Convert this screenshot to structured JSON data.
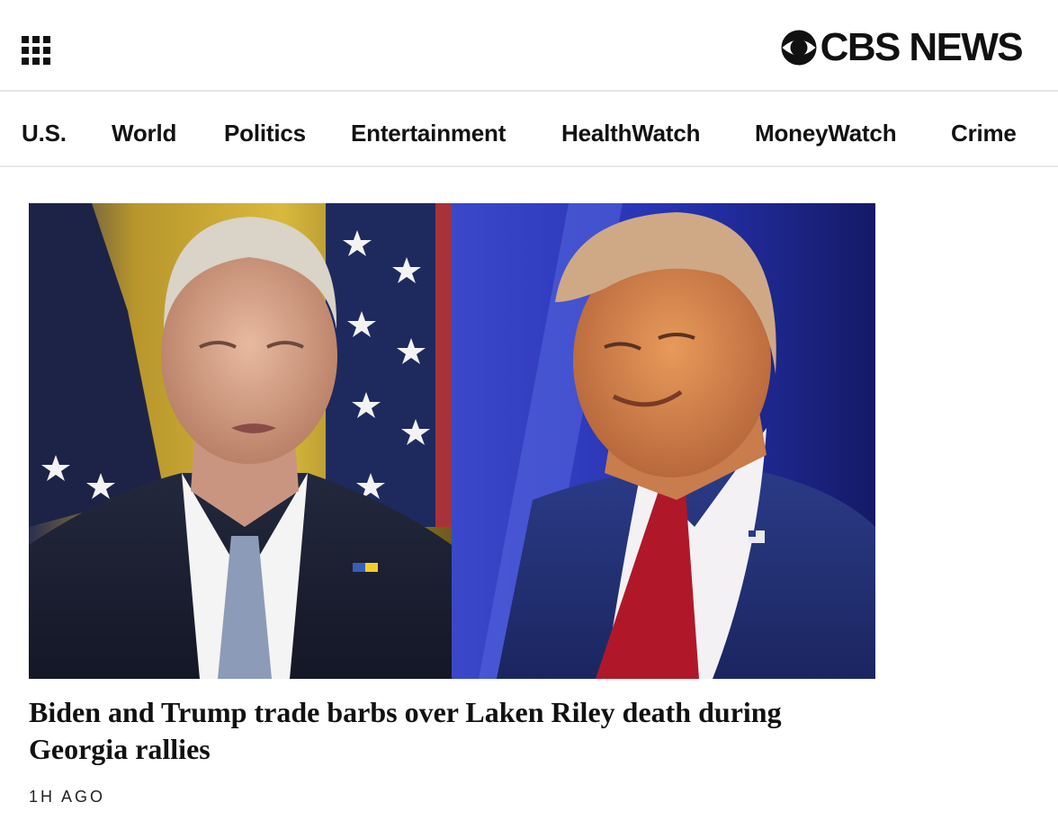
{
  "header": {
    "menu_icon": "grid-menu-icon",
    "logo_icon": "cbs-eye-icon",
    "logo_text": "CBS NEWS"
  },
  "nav": {
    "items": [
      {
        "label": "U.S."
      },
      {
        "label": "World"
      },
      {
        "label": "Politics"
      },
      {
        "label": "Entertainment"
      },
      {
        "label": "HealthWatch"
      },
      {
        "label": "MoneyWatch"
      },
      {
        "label": "Crime"
      }
    ]
  },
  "story": {
    "image_alt": "Split photo of Joe Biden and Donald Trump",
    "headline": "Biden and Trump trade barbs over Laken Riley death during Georgia rallies",
    "timestamp": "1H AGO"
  },
  "colors": {
    "text": "#111111",
    "divider": "#e4e4e4",
    "background": "#ffffff"
  }
}
